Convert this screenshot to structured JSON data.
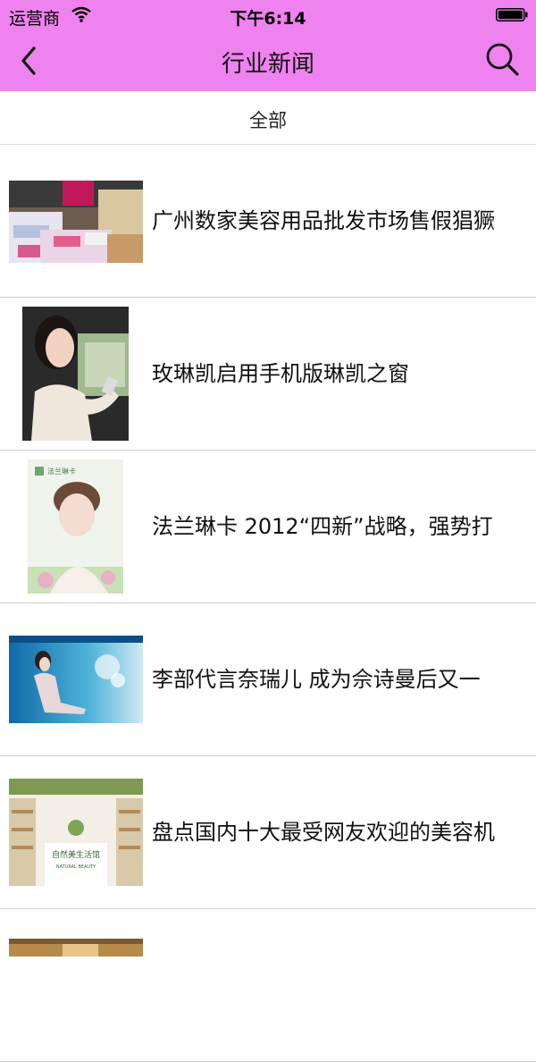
{
  "status_bar": {
    "carrier": "运营商",
    "time": "下午6:14"
  },
  "nav": {
    "title": "行业新闻"
  },
  "tabs": {
    "all": "全部"
  },
  "news": [
    {
      "title": "广州数家美容用品批发市场售假猖獗"
    },
    {
      "title": "玫琳凯启用手机版琳凯之窗"
    },
    {
      "title": "法兰琳卡 2012“四新”战略，强势打"
    },
    {
      "title": "李部代言奈瑞儿 成为佘诗曼后又一"
    },
    {
      "title": "盘点国内十大最受网友欢迎的美容机"
    }
  ],
  "thumb_text": {
    "brand_small": "法兰琳卡",
    "shop_sign": "自然美生活馆",
    "shop_sign_en": "NATURAL BEAUTY"
  },
  "colors": {
    "header": "#ee82ee",
    "divider": "#cfcfcf"
  }
}
